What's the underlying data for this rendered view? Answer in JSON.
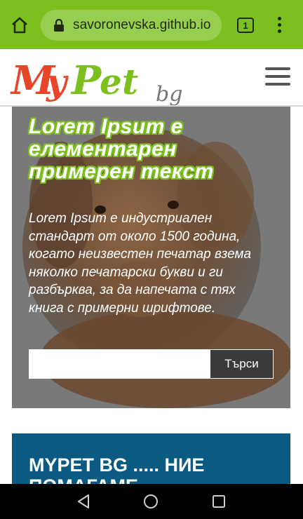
{
  "browser": {
    "url": "savoronevska.github.io",
    "tab_count": "1"
  },
  "site": {
    "logo_text": "MyPet",
    "logo_suffix": "bg"
  },
  "hero": {
    "title": "Lorem Ipsum е елементарен примерен текст",
    "description": "Lorem Ipsum е индустриален стандарт от около 1500 година, когато неизвестен печатар взема няколко печатарски букви и ги разбърква, за да напечата с тях книга с примерни шрифтове.",
    "search_placeholder": "",
    "search_button": "Търси"
  },
  "about": {
    "title": "MYPET BG ..... НИЕ ПОМАГАМЕ"
  },
  "colors": {
    "browser_bar": "#7cc01f",
    "logo_red": "#e8462a",
    "logo_green": "#7cc01f",
    "about_bg": "#0a5a82"
  },
  "icons": {
    "home": "home-icon",
    "lock": "lock-icon",
    "menu": "hamburger-icon",
    "more": "more-vert-icon",
    "nav_back": "back-triangle-icon",
    "nav_home": "home-circle-icon",
    "nav_recent": "recent-square-icon"
  }
}
